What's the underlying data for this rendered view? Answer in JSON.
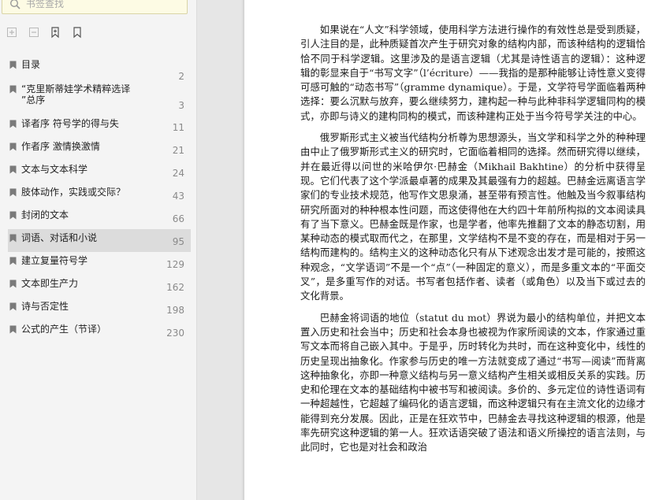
{
  "sidebar": {
    "search": {
      "placeholder": "书签查找"
    },
    "toolbar": [
      "expand-all",
      "collapse-all",
      "add-bookmark",
      "bookmark-options"
    ],
    "bookmarks": [
      {
        "label": "目录",
        "page": "2"
      },
      {
        "label": "“克里斯蒂娃学术精粹选译\n”总序",
        "page": "3"
      },
      {
        "label": "译者序 符号学的得与失",
        "page": "11"
      },
      {
        "label": "作者序 激情换激情",
        "page": "21"
      },
      {
        "label": "文本与文本科学",
        "page": "24"
      },
      {
        "label": "肢体动作，实践或交际？",
        "page": "43"
      },
      {
        "label": "封闭的文本",
        "page": "66"
      },
      {
        "label": "词语、对话和小说",
        "page": "95",
        "selected": true
      },
      {
        "label": "建立复量符号学",
        "page": "129"
      },
      {
        "label": "文本即生产力",
        "page": "162"
      },
      {
        "label": "诗与否定性",
        "page": "198"
      },
      {
        "label": "公式的产生（节译）",
        "page": "230"
      }
    ]
  },
  "document": {
    "paragraphs": [
      "如果说在“人文”科学领域，使用科学方法进行操作的有效性总是受到质疑，引人注目的是，此种质疑首次产生于研究对象的结构内部，而该种结构的逻辑恰恰不同于科学逻辑。这里涉及的是语言逻辑（尤其是诗性语言的逻辑）：这种逻辑的彰显来自于“书写文字”（l’écriture）——我指的是那种能够让诗性意义变得可感可触的“动态书写”（gramme dynamique）。于是，文学符号学面临着两种选择：要么沉默与放弃，要么继续努力，建构起一种与此种非科学逻辑同构的模式，亦即与诗义的建构同构的模式，而该种建构正处于当今符号学关注的中心。",
      "俄罗斯形式主义被当代结构分析尊为思想源头，当文学和科学之外的种种理由中止了俄罗斯形式主义的研究时，它面临着相同的选择。然而研究得以继续，并在最近得以问世的米哈伊尔·巴赫金（Mikhail Bakhtine）的分析中获得呈现。它们代表了这个学派最卓著的成果及其最强有力的超越。巴赫金远离语言学家们的专业技术规范，他写作文思泉涌，甚至带有预言性。他触及当今叙事结构研究所面对的种种根本性问题，而这使得他在大约四十年前所构拟的文本阅读具有了当下意义。巴赫金既是作家，也是学者，他率先推翻了文本的静态切割，用某种动态的模式取而代之，在那里，文学结构不是不变的存在，而是相对于另一结构而建构的。结构主义的这种动态化只有从下述观念出发才是可能的，按照这种观念，“文学语词”不是一个“点”（一种固定的意义），而是多重文本的“平面交叉”，是多重写作的对话。书写者包括作者、读者（或角色）以及当下或过去的文化背景。",
      "巴赫金将词语的地位（statut du mot）界说为最小的结构单位，并把文本置入历史和社会当中；历史和社会本身也被视为作家所阅读的文本，作家通过重写文本而将自己嵌入其中。于是乎，历时转化为共时，而在这种变化中，线性的历史呈现出抽象化。作家参与历史的唯一方法就变成了通过“书写—阅读”而背离这种抽象化，亦即一种意义结构与另一意义结构产生相关或相反关系的实践。历史和伦理在文本的基础结构中被书写和被阅读。多价的、多元定位的诗性语词有一种超越性，它超越了编码化的语言逻辑，而这种逻辑只有在主流文化的边缘才能得到充分发展。因此，正是在狂欢节中，巴赫金去寻找这种逻辑的根源，他是率先研究这种逻辑的第一人。狂欢话语突破了语法和语义所操控的语言法则，与此同时，它也是对社会和政治"
    ]
  }
}
